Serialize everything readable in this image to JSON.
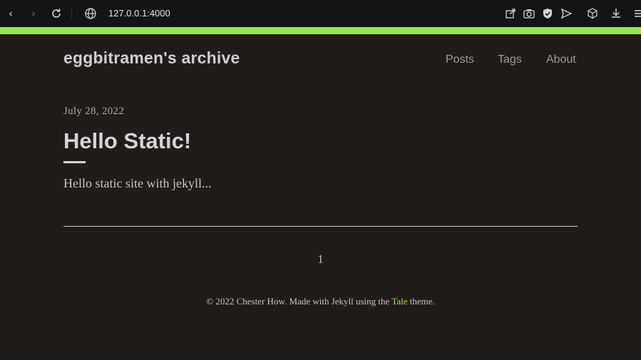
{
  "browser": {
    "url": "127.0.0.1:4000",
    "icons": {
      "back": "arrow-left-icon",
      "forward": "arrow-right-icon",
      "reload": "reload-icon",
      "site_info": "globe-icon",
      "share": "share-icon",
      "screenshot": "camera-icon",
      "shield": "shield-icon",
      "send": "send-icon",
      "extension": "cube-icon",
      "download": "download-icon",
      "menu": "menu-icon"
    }
  },
  "accent_color": "#9ee05c",
  "site": {
    "title": "eggbitramen's archive",
    "nav": [
      "Posts",
      "Tags",
      "About"
    ]
  },
  "post": {
    "date": "July 28, 2022",
    "title": "Hello Static!",
    "excerpt": "Hello static site with jekyll..."
  },
  "pagination": {
    "current_page": "1"
  },
  "footer": {
    "prefix": "© 2022 Chester How. Made with Jekyll using the",
    "theme_link": "Tale",
    "suffix": "theme."
  }
}
